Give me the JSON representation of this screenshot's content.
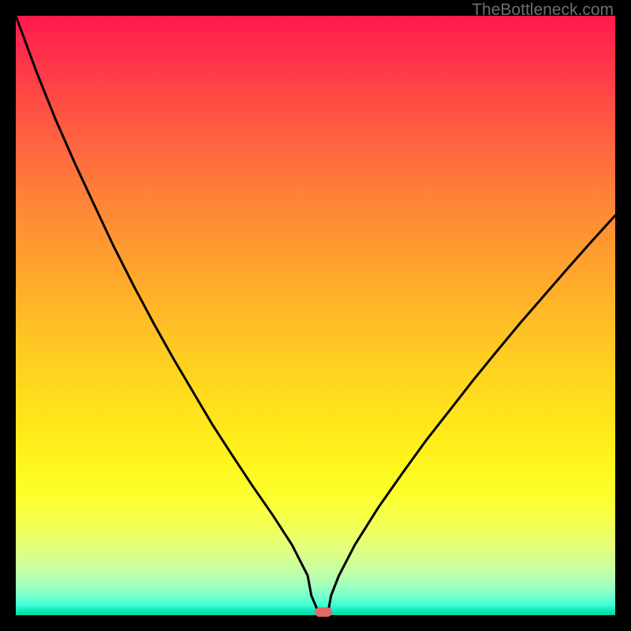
{
  "watermark": "TheBottleneck.com",
  "colors": {
    "frame": "#000000",
    "curve": "#000000",
    "marker": "#e06a66"
  },
  "chart_data": {
    "type": "line",
    "title": "",
    "xlabel": "",
    "ylabel": "",
    "xlim": [
      0,
      1
    ],
    "ylim": [
      0,
      100
    ],
    "grid": false,
    "x": [
      0.0,
      0.034,
      0.066,
      0.099,
      0.132,
      0.164,
      0.197,
      0.23,
      0.263,
      0.296,
      0.328,
      0.361,
      0.394,
      0.428,
      0.461,
      0.487,
      0.493,
      0.507,
      0.52,
      0.526,
      0.539,
      0.566,
      0.605,
      0.645,
      0.684,
      0.724,
      0.763,
      0.803,
      0.842,
      0.882,
      0.921,
      0.961,
      1.0
    ],
    "values": [
      100.0,
      90.8,
      82.8,
      75.3,
      68.2,
      61.4,
      54.9,
      48.7,
      42.8,
      37.2,
      31.8,
      26.7,
      21.7,
      16.8,
      11.7,
      6.6,
      3.3,
      0.0,
      0.0,
      3.3,
      6.6,
      11.8,
      18.0,
      23.7,
      29.1,
      34.2,
      39.2,
      44.1,
      48.8,
      53.4,
      57.9,
      62.4,
      66.7
    ],
    "marker": {
      "x": 0.513,
      "y": 0.0
    },
    "annotations": []
  }
}
